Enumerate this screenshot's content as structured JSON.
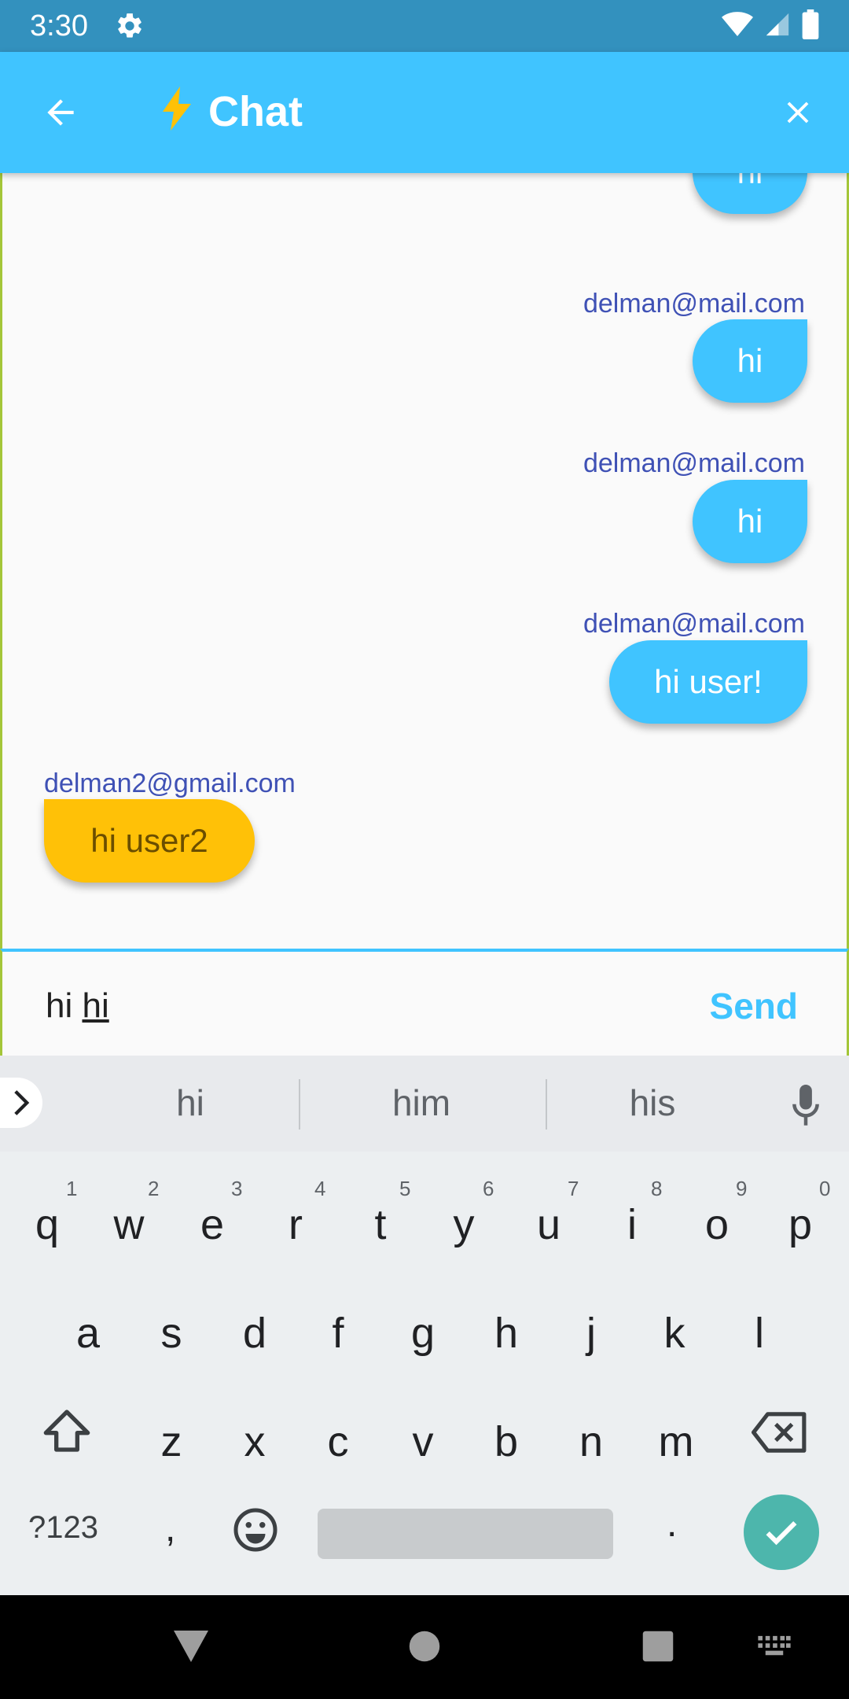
{
  "status_bar": {
    "time": "3:30",
    "icons": [
      "settings-icon",
      "wifi-icon",
      "signal-icon",
      "battery-icon"
    ]
  },
  "app_bar": {
    "title_emoji": "⚡",
    "title": "Chat",
    "back_icon": "arrow-back-icon",
    "close_icon": "close-icon",
    "color": "#40c4ff"
  },
  "messages": [
    {
      "sender": "",
      "text": "hi",
      "side": "right"
    },
    {
      "sender": "delman@mail.com",
      "text": "hi",
      "side": "right"
    },
    {
      "sender": "delman@mail.com",
      "text": "hi",
      "side": "right"
    },
    {
      "sender": "delman@mail.com",
      "text": "hi user!",
      "side": "right"
    },
    {
      "sender": "delman2@gmail.com",
      "text": "hi user2",
      "side": "left"
    }
  ],
  "composer": {
    "text_committed": "hi ",
    "text_composing": "hi",
    "send_label": "Send"
  },
  "keyboard": {
    "suggestions": [
      "hi",
      "him",
      "his"
    ],
    "row1": [
      "q",
      "w",
      "e",
      "r",
      "t",
      "y",
      "u",
      "i",
      "o",
      "p"
    ],
    "row1_hints": [
      "1",
      "2",
      "3",
      "4",
      "5",
      "6",
      "7",
      "8",
      "9",
      "0"
    ],
    "row2": [
      "a",
      "s",
      "d",
      "f",
      "g",
      "h",
      "j",
      "k",
      "l"
    ],
    "row3": [
      "z",
      "x",
      "c",
      "v",
      "b",
      "n",
      "m"
    ],
    "symbols_label": "?123",
    "comma": ",",
    "period": ".",
    "icons": [
      "expand-icon",
      "mic-icon",
      "shift-icon",
      "backspace-icon",
      "emoji-icon",
      "check-icon"
    ],
    "enter_color": "#4db6ac"
  },
  "nav_bar": {
    "icons": [
      "back-triangle-icon",
      "home-circle-icon",
      "recents-square-icon",
      "keyboard-switch-icon"
    ]
  },
  "colors": {
    "outgoing_bubble": "#40c4ff",
    "incoming_bubble": "#ffc107",
    "sender_text": "#3f51b5"
  }
}
